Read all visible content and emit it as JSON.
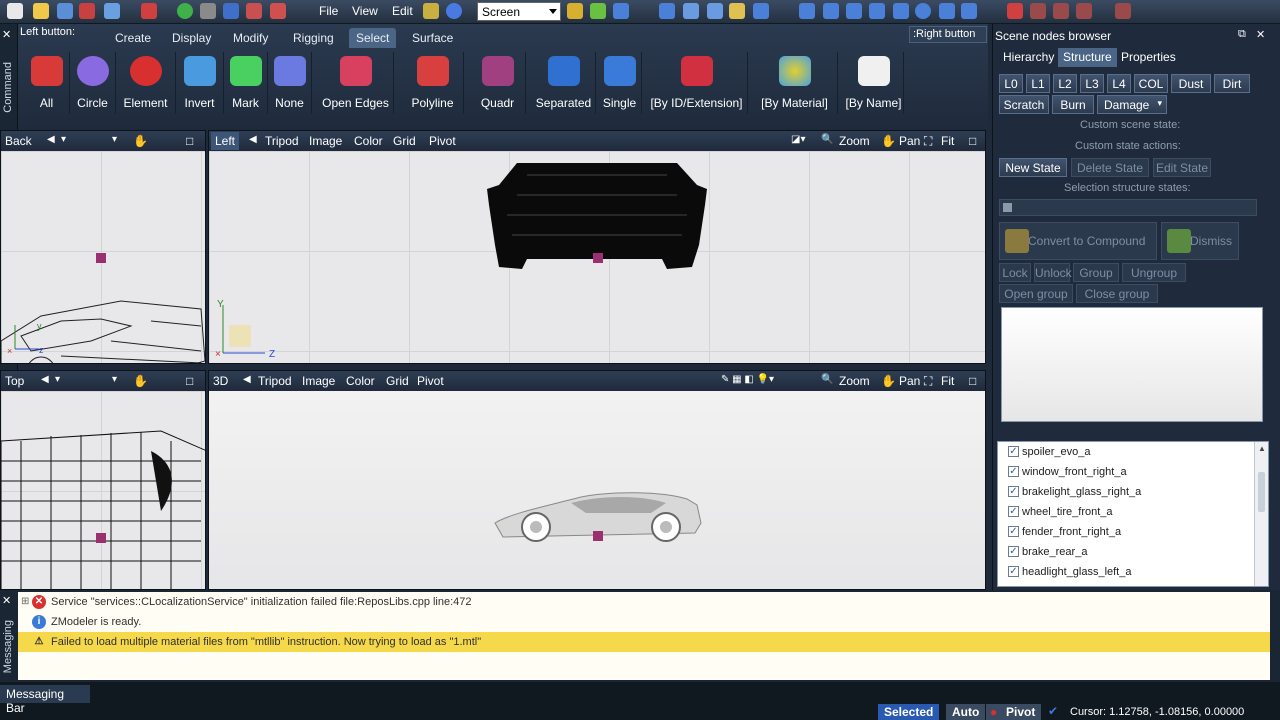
{
  "menu": {
    "file": "File",
    "view": "View",
    "edit": "Edit",
    "screen": "Screen"
  },
  "strip": {
    "command": "Command",
    "messaging": "Messaging"
  },
  "command_panel": {
    "left_button": "Left button:",
    "right_button": ":Right button",
    "tabs": [
      "Create",
      "Display",
      "Modify",
      "Rigging",
      "Select",
      "Surface"
    ],
    "buttons": [
      "All",
      "Circle",
      "Element",
      "Invert",
      "Mark",
      "None",
      "Open Edges",
      "Polyline",
      "Quadr",
      "Separated",
      "Single",
      "[By ID/Extension]",
      "[By Material]",
      "[By Name]"
    ]
  },
  "viewports": {
    "back": {
      "name": "Back"
    },
    "left": {
      "name": "Left",
      "tripod": "Tripod",
      "image": "Image",
      "color": "Color",
      "grid": "Grid",
      "pivot": "Pivot",
      "zoom": "Zoom",
      "pan": "Pan",
      "fit": "Fit"
    },
    "top": {
      "name": "Top"
    },
    "view3d": {
      "name": "3D",
      "tripod": "Tripod",
      "image": "Image",
      "color": "Color",
      "grid": "Grid",
      "pivot": "Pivot",
      "zoom": "Zoom",
      "pan": "Pan",
      "fit": "Fit"
    }
  },
  "scene": {
    "title": "Scene nodes browser",
    "tabs": [
      "Hierarchy",
      "Structure",
      "Properties"
    ],
    "levels": [
      "L0",
      "L1",
      "L2",
      "L3",
      "L4",
      "COL",
      "Dust",
      "Dirt"
    ],
    "row2": [
      "Scratch",
      "Burn",
      "Damage"
    ],
    "custom_scene_state": "Custom scene state:",
    "custom_state_actions": "Custom state actions:",
    "state_buttons": [
      "New State",
      "Delete State",
      "Edit State"
    ],
    "selection_states": "Selection structure states:",
    "convert": "Convert to Compound",
    "dismiss": "Dismiss",
    "group_buttons": [
      "Lock",
      "Unlock",
      "Group",
      "Ungroup"
    ],
    "group_buttons2": [
      "Open group",
      "Close group"
    ],
    "nodes": [
      "spoiler_evo_a",
      "window_front_right_a",
      "brakelight_glass_right_a",
      "wheel_tire_front_a",
      "fender_front_right_a",
      "brake_rear_a",
      "headlight_glass_left_a"
    ]
  },
  "messages": [
    {
      "type": "error",
      "text": "Service \"services::CLocalizationService\" initialization failed file:ReposLibs.cpp line:472"
    },
    {
      "type": "info",
      "text": "ZModeler is ready."
    },
    {
      "type": "warning",
      "text": "Failed to load multiple material files from \"mtllib\" instruction. Now trying to load as \"1.mtl\""
    }
  ],
  "status": {
    "messaging_bar": "Messaging Bar",
    "selected": "Selected",
    "auto": "Auto",
    "pivot": "Pivot",
    "cursor": "Cursor: 1.12758, -1.08156, 0.00000"
  }
}
